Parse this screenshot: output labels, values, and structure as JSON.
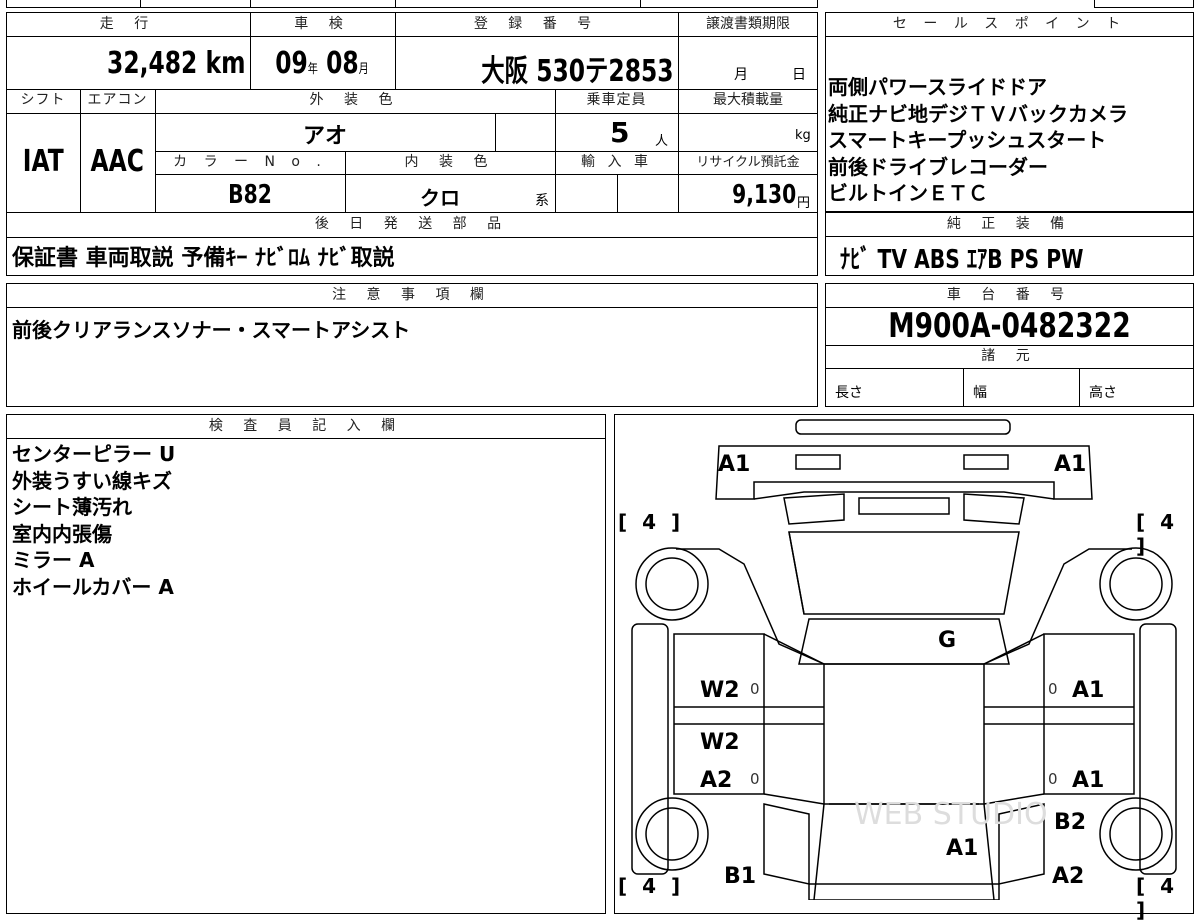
{
  "headers": {
    "mileage": "走 行",
    "shaken": "車 検",
    "reg_no": "登 録 番 号",
    "doc_deadline": "譲渡書類期限",
    "sales_point": "セ ー ル ス ポ イ ン ト",
    "shift": "シフト",
    "ac": "エアコン",
    "ext_color": "外 装 色",
    "capacity": "乗車定員",
    "max_load": "最大積載量",
    "color_no": "カ ラ ー N o .",
    "int_color": "内 装 色",
    "import": "輸 入 車",
    "recycle": "リサイクル預託金",
    "later_parts": "後 日 発 送 部 品",
    "oem_equip": "純 正 装 備",
    "notes": "注 意 事 項 欄",
    "chassis_no": "車 台 番 号",
    "specs": "諸 元",
    "inspector": "検 査 員 記 入 欄"
  },
  "vehicle": {
    "mileage_value": "32,482",
    "mileage_unit": "km",
    "shaken_year": "09",
    "year_unit": "年",
    "shaken_month": "08",
    "month_unit": "月",
    "reg_number": "大阪 530テ2853",
    "deadline_month": "月",
    "deadline_day": "日",
    "shift": "IAT",
    "ac": "AAC",
    "ext_color": "アオ",
    "capacity": "5",
    "capacity_unit": "人",
    "max_load_unit": "kg",
    "color_no": "B82",
    "int_color": "クロ",
    "int_suffix": "系",
    "recycle_fee": "9,130",
    "yen": "円",
    "chassis_number": "M900A-0482322"
  },
  "sales_points": [
    "両側パワースライドドア",
    "純正ナビ地デジＴＶバックカメラ",
    "スマートキープッシュスタート",
    "前後ドライブレコーダー",
    "ビルトインＥＴＣ"
  ],
  "later_parts_text": "保証書 車両取説 予備ｷｰ ﾅﾋﾞﾛﾑ ﾅﾋﾞ取説",
  "oem_equipment_text": "ﾅﾋﾞ TV ABS ｴｱB PS PW",
  "notes_text": "前後クリアランスソナー・スマートアシスト",
  "specs": {
    "length": "長さ",
    "width": "幅",
    "height": "高さ"
  },
  "inspector_notes": [
    "センターピラー U",
    "外装うすい線キズ",
    "シート薄汚れ",
    "室内内張傷",
    "ミラー A",
    "ホイールカバー A"
  ],
  "diagram": {
    "tire_label": "[ 4 ]",
    "marks": {
      "front_left": "A1",
      "front_right": "A1",
      "roof": "G",
      "left_front_door": "W2",
      "left_rear_door_top": "W2",
      "left_rear_door": "A2",
      "left_rear_quarter": "B1",
      "right_front_door": "A1",
      "right_rear_door": "A1",
      "right_rear_quarter": "B2",
      "right_rear_bottom": "A2",
      "rear_hatch": "A1",
      "zero": "0"
    },
    "watermark": "WEB STUDIO"
  }
}
